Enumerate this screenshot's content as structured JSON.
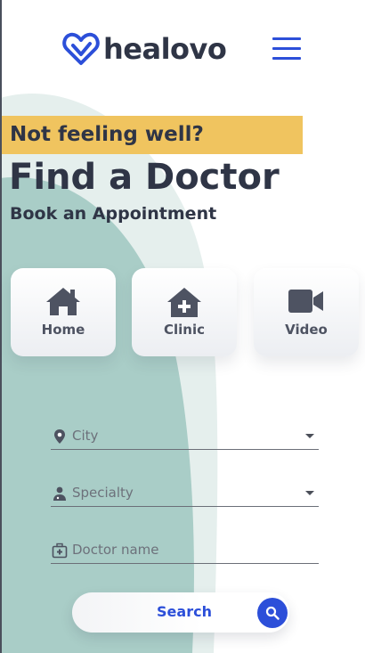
{
  "brand": {
    "name": "healovo",
    "colors": {
      "primary": "#2c4fd9",
      "accent": "#f0c45f",
      "text": "#2f3546",
      "background_shape": "#a9cdc7"
    },
    "logo_icon": "heart-check-icon"
  },
  "header": {
    "menu_icon": "hamburger-menu-icon"
  },
  "hero": {
    "tag": "Not feeling well?",
    "title": "Find a Doctor",
    "subtitle": "Book an Appointment"
  },
  "visit_types": [
    {
      "label": "Home",
      "icon": "house-icon"
    },
    {
      "label": "Clinic",
      "icon": "clinic-plus-icon"
    },
    {
      "label": "Video",
      "icon": "video-camera-icon"
    }
  ],
  "form": {
    "city": {
      "value": "",
      "placeholder": "City",
      "icon": "location-pin-icon"
    },
    "specialty": {
      "value": "",
      "placeholder": "Specialty",
      "icon": "doctor-icon"
    },
    "doctor": {
      "value": "",
      "placeholder": "Doctor name",
      "icon": "medical-bag-icon"
    }
  },
  "search_button": {
    "label": "Search",
    "icon": "search-icon"
  }
}
